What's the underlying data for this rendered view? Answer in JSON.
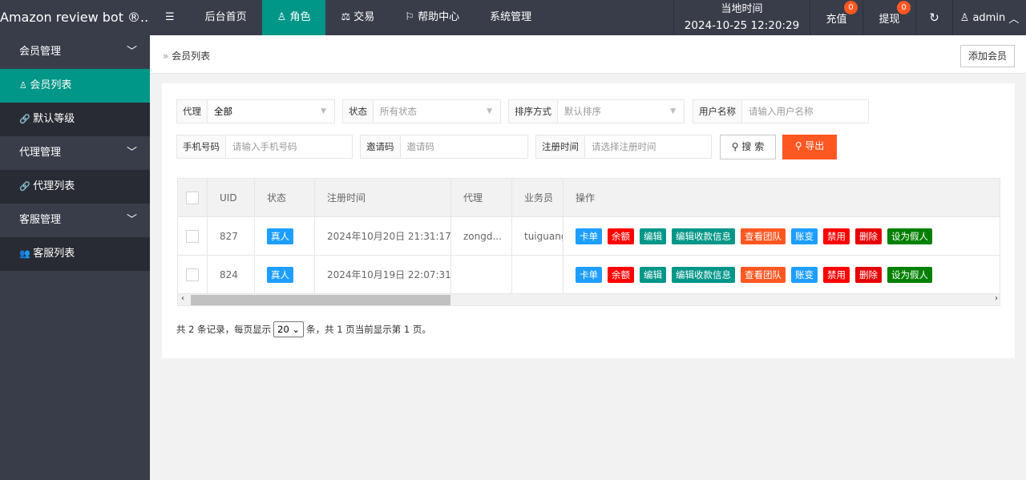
{
  "header": {
    "logo": "Amazon review bot ®...",
    "menu_icon": "menu-icon",
    "nav": [
      {
        "label": "后台首页",
        "icon": ""
      },
      {
        "label": "角色",
        "icon": "user-icon",
        "active": true
      },
      {
        "label": "交易",
        "icon": "scale-icon"
      },
      {
        "label": "帮助中心",
        "icon": "flag-icon"
      },
      {
        "label": "系统管理",
        "icon": ""
      }
    ],
    "time_label": "当地时间",
    "time_value": "2024-10-25 12:20:29",
    "recharge": "充值",
    "recharge_count": "0",
    "withdraw": "提现",
    "withdraw_count": "0",
    "user": "admin"
  },
  "sidebar": [
    {
      "label": "会员管理",
      "type": "group"
    },
    {
      "label": "会员列表",
      "type": "sub",
      "active": true,
      "icon": "user-icon"
    },
    {
      "label": "默认等级",
      "type": "sub",
      "icon": "link-icon"
    },
    {
      "label": "代理管理",
      "type": "group"
    },
    {
      "label": "代理列表",
      "type": "sub",
      "icon": "link-icon"
    },
    {
      "label": "客服管理",
      "type": "group"
    },
    {
      "label": "客服列表",
      "type": "sub",
      "icon": "users-icon"
    }
  ],
  "breadcrumb": "会员列表",
  "add_button": "添加会员",
  "filters": {
    "agent_label": "代理",
    "agent_value": "全部",
    "status_label": "状态",
    "status_value": "所有状态",
    "sort_label": "排序方式",
    "sort_value": "默认排序",
    "username_label": "用户名称",
    "username_placeholder": "请输入用户名称",
    "phone_label": "手机号码",
    "phone_placeholder": "请输入手机号码",
    "invite_label": "邀请码",
    "invite_placeholder": "邀请码",
    "regtime_label": "注册时间",
    "regtime_placeholder": "请选择注册时间",
    "search": "搜 索",
    "export": "导出"
  },
  "table": {
    "headers": [
      "UID",
      "状态",
      "注册时间",
      "代理",
      "业务员",
      "操作"
    ],
    "rows": [
      {
        "uid": "827",
        "status": "真人",
        "time": "2024年10月20日 21:31:17",
        "agent": "zongd...",
        "sales": "tuiguang"
      },
      {
        "uid": "824",
        "status": "真人",
        "time": "2024年10月19日 22:07:31",
        "agent": "",
        "sales": ""
      }
    ],
    "actions": [
      {
        "label": "卡单",
        "color": "#1E9FFF"
      },
      {
        "label": "余额",
        "color": "#FF0000"
      },
      {
        "label": "编辑",
        "color": "#009688"
      },
      {
        "label": "编辑收款信息",
        "color": "#009688"
      },
      {
        "label": "查看团队",
        "color": "#FF5722"
      },
      {
        "label": "账变",
        "color": "#1E9FFF"
      },
      {
        "label": "禁用",
        "color": "#FF0000"
      },
      {
        "label": "删除",
        "color": "#E60000"
      },
      {
        "label": "设为假人",
        "color": "#008000"
      }
    ]
  },
  "pagination": {
    "prefix": "共 2 条记录，每页显示",
    "page_size": "20",
    "suffix": "条，共 1 页当前显示第 1 页。"
  }
}
